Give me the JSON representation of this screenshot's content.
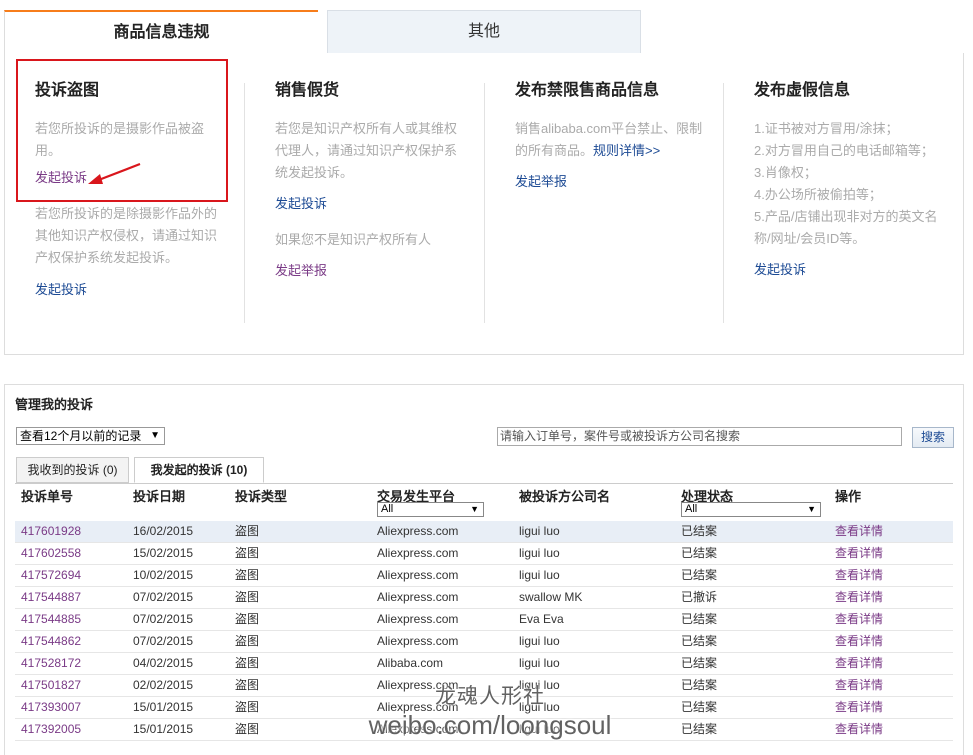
{
  "top_tabs": {
    "active": "商品信息违规",
    "inactive": "其他"
  },
  "columns": [
    {
      "title": "投诉盗图",
      "desc": "若您所投诉的是摄影作品被盗用。",
      "link": "发起投诉",
      "desc2": "若您所投诉的是除摄影作品外的其他知识产权侵权，请通过知识产权保护系统发起投诉。",
      "link2": "发起投诉"
    },
    {
      "title": "销售假货",
      "desc": "若您是知识产权所有人或其维权代理人，请通过知识产权保护系统发起投诉。",
      "link": "发起投诉",
      "desc2": "如果您不是知识产权所有人",
      "link2": "发起举报"
    },
    {
      "title": "发布禁限售商品信息",
      "desc": "销售alibaba.com平台禁止、限制的所有商品。",
      "rule_link": "规则详情>>",
      "link": "发起举报"
    },
    {
      "title": "发布虚假信息",
      "items": [
        "1.证书被对方冒用/涂抹；",
        "2.对方冒用自己的电话邮箱等；",
        "3.肖像权；",
        "4.办公场所被偷拍等；",
        "5.产品/店铺出现非对方的英文名称/网址/会员ID等。"
      ],
      "link": "发起投诉"
    }
  ],
  "manage": {
    "title": "管理我的投诉",
    "range_select": "查看12个月以前的记录",
    "search_placeholder": "请输入订单号，案件号或被投诉方公司名搜索",
    "search_button": "搜索",
    "tabs": [
      "我收到的投诉 (0)",
      "我发起的投诉 (10)"
    ],
    "headers": [
      "投诉单号",
      "投诉日期",
      "投诉类型",
      "交易发生平台",
      "被投诉方公司名",
      "处理状态",
      "操作"
    ],
    "platform_filter": "All",
    "status_filter": "All",
    "rows": [
      {
        "id": "417601928",
        "date": "16/02/2015",
        "type": "盗图",
        "platform": "Aliexpress.com",
        "company": "ligui luo",
        "status": "已结案",
        "action": "查看详情"
      },
      {
        "id": "417602558",
        "date": "15/02/2015",
        "type": "盗图",
        "platform": "Aliexpress.com",
        "company": "ligui luo",
        "status": "已结案",
        "action": "查看详情"
      },
      {
        "id": "417572694",
        "date": "10/02/2015",
        "type": "盗图",
        "platform": "Aliexpress.com",
        "company": "ligui luo",
        "status": "已结案",
        "action": "查看详情"
      },
      {
        "id": "417544887",
        "date": "07/02/2015",
        "type": "盗图",
        "platform": "Aliexpress.com",
        "company": "swallow MK",
        "status": "已撤诉",
        "action": "查看详情"
      },
      {
        "id": "417544885",
        "date": "07/02/2015",
        "type": "盗图",
        "platform": "Aliexpress.com",
        "company": "Eva Eva",
        "status": "已结案",
        "action": "查看详情"
      },
      {
        "id": "417544862",
        "date": "07/02/2015",
        "type": "盗图",
        "platform": "Aliexpress.com",
        "company": "ligui luo",
        "status": "已结案",
        "action": "查看详情"
      },
      {
        "id": "417528172",
        "date": "04/02/2015",
        "type": "盗图",
        "platform": "Alibaba.com",
        "company": "ligui luo",
        "status": "已结案",
        "action": "查看详情"
      },
      {
        "id": "417501827",
        "date": "02/02/2015",
        "type": "盗图",
        "platform": "Aliexpress.com",
        "company": "ligui luo",
        "status": "已结案",
        "action": "查看详情"
      },
      {
        "id": "417393007",
        "date": "15/01/2015",
        "type": "盗图",
        "platform": "Aliexpress.com",
        "company": "ligui luo",
        "status": "已结案",
        "action": "查看详情"
      },
      {
        "id": "417392005",
        "date": "15/01/2015",
        "type": "盗图",
        "platform": "Aliexpress.com",
        "company": "ligui luo",
        "status": "已结案",
        "action": "查看详情"
      }
    ]
  },
  "watermark": {
    "line1": "龙魂人形社",
    "line2": "weibo.com/loongsoul"
  },
  "colors": {
    "accent_orange": "#f77d1b",
    "highlight_red": "#d9161c",
    "link_blue": "#1c4a94",
    "link_purple": "#7a3a86"
  }
}
